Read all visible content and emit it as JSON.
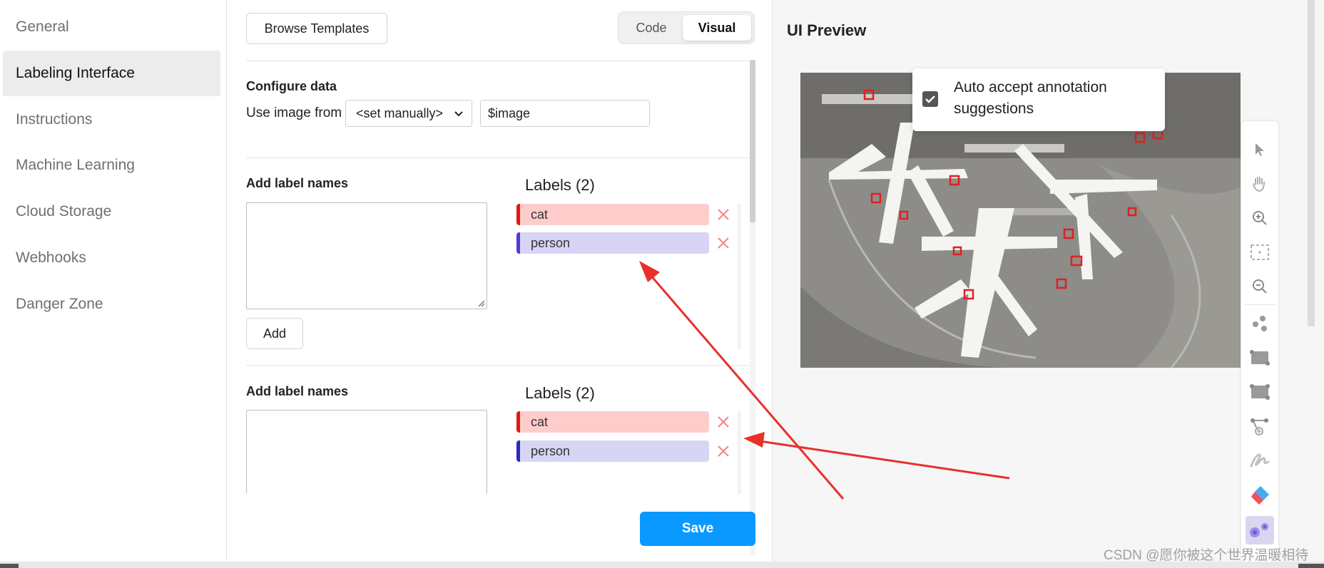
{
  "sidebar": {
    "items": [
      {
        "label": "General"
      },
      {
        "label": "Labeling Interface"
      },
      {
        "label": "Instructions"
      },
      {
        "label": "Machine Learning"
      },
      {
        "label": "Cloud Storage"
      },
      {
        "label": "Webhooks"
      },
      {
        "label": "Danger Zone"
      }
    ],
    "active_index": 1
  },
  "main": {
    "browse_templates": "Browse Templates",
    "mode_toggle": {
      "code": "Code",
      "visual": "Visual",
      "selected": "Visual"
    },
    "configure": {
      "title": "Configure data",
      "use_from_label": "Use image from",
      "select_value": "<set manually>",
      "input_value": "$image"
    },
    "label_blocks": [
      {
        "add_title": "Add label names",
        "add_button": "Add",
        "labels_title": "Labels (2)",
        "labels": [
          {
            "name": "cat",
            "color": "#e01818"
          },
          {
            "name": "person",
            "color": "#4f3bd6"
          }
        ]
      },
      {
        "add_title": "Add label names",
        "labels_title": "Labels (2)",
        "labels": [
          {
            "name": "cat",
            "color": "#e01818"
          },
          {
            "name": "person",
            "color": "#2a29c0"
          }
        ]
      }
    ],
    "save": "Save"
  },
  "preview": {
    "title": "UI Preview",
    "auto_accept": {
      "text": "Auto accept annotation suggestions",
      "checked": true
    },
    "tools": [
      "pointer-icon",
      "hand-icon",
      "zoom-in-icon",
      "fit-icon",
      "zoom-out-icon",
      "keypoint-icon",
      "rectangle-icon",
      "rectangle-3point-icon",
      "polygon-icon",
      "brush-icon",
      "eraser-icon",
      "magic-wand-icon"
    ]
  },
  "watermark": "CSDN @愿你被这个世界温暖相待",
  "colors": {
    "accent": "#0a99ff",
    "annotation_arrow": "#e8302a"
  }
}
